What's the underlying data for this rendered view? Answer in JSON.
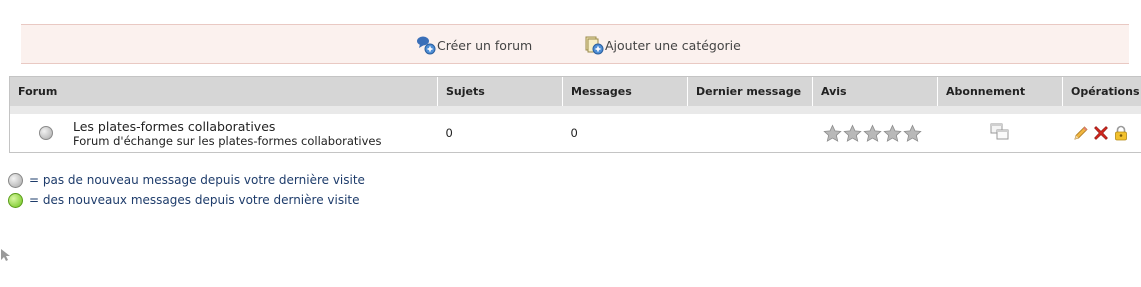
{
  "toolbar": {
    "create_forum_label": "Créer un forum",
    "add_category_label": "Ajouter une catégorie"
  },
  "table": {
    "headers": {
      "forum": "Forum",
      "topics": "Sujets",
      "messages": "Messages",
      "last_message": "Dernier message",
      "rating": "Avis",
      "subscription": "Abonnement",
      "operations": "Opérations"
    },
    "rows": [
      {
        "title": "Les plates-formes collaboratives",
        "description": "Forum d'échange sur les plates-formes collaboratives",
        "topics": "0",
        "messages": "0",
        "last_message": "",
        "rating_stars": 0,
        "rating_max": 5,
        "status_icon": "no-new-messages-dot",
        "subscription_icon": "subscribe-windows-icon",
        "operations_icons": [
          "edit-pencil-icon",
          "delete-x-icon",
          "lock-icon"
        ]
      }
    ]
  },
  "legend": {
    "no_new": "= pas de nouveau message depuis votre dernière visite",
    "new": "= des nouveaux messages depuis votre dernière visite"
  },
  "colors": {
    "toolbar_bg": "#fbf1ee",
    "header_bg": "#d6d6d6",
    "legend_text": "#1e3c6b",
    "new_dot": "#6dc21c",
    "old_dot": "#a9a9a9"
  }
}
